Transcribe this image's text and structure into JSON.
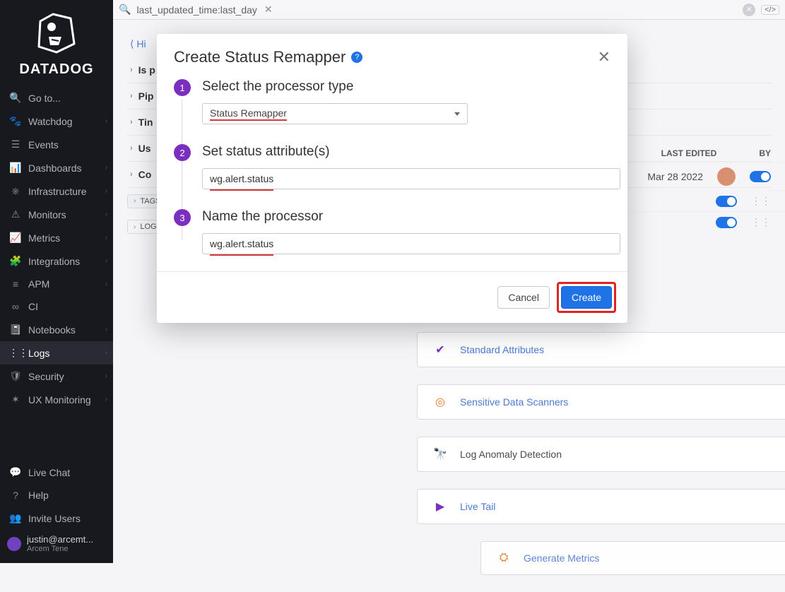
{
  "brand": "DATADOG",
  "sidebar": {
    "goto": "Go to...",
    "items": [
      {
        "label": "Watchdog"
      },
      {
        "label": "Events"
      },
      {
        "label": "Dashboards"
      },
      {
        "label": "Infrastructure"
      },
      {
        "label": "Monitors"
      },
      {
        "label": "Metrics"
      },
      {
        "label": "Integrations"
      },
      {
        "label": "APM"
      },
      {
        "label": "CI"
      },
      {
        "label": "Notebooks"
      },
      {
        "label": "Logs"
      },
      {
        "label": "Security"
      },
      {
        "label": "UX Monitoring"
      }
    ],
    "bottom": [
      {
        "label": "Live Chat"
      },
      {
        "label": "Help"
      },
      {
        "label": "Invite Users"
      }
    ],
    "user": {
      "email": "justin@arcemt...",
      "org": "Arcem Tene"
    }
  },
  "topbar": {
    "filter": "last_updated_time:last_day"
  },
  "accordion": {
    "back": "Hi",
    "rows": [
      "Is p",
      "Pip",
      "Tin",
      "Us",
      "Co"
    ],
    "tags": "TAGS",
    "logs": "LOGS"
  },
  "table": {
    "col1": "LAST EDITED",
    "col2": "BY",
    "date": "Mar 28 2022"
  },
  "cards": {
    "std": "Standard Attributes",
    "sds": "Sensitive Data Scanners",
    "lad": "Log Anomaly Detection",
    "lt": "Live Tail",
    "gm": "Generate Metrics"
  },
  "modal": {
    "title": "Create Status Remapper",
    "step1_title": "Select the processor type",
    "step1_value": "Status Remapper",
    "step2_title": "Set status attribute(s)",
    "step2_value": "wg.alert.status",
    "step3_title": "Name the processor",
    "step3_value": "wg.alert.status",
    "cancel": "Cancel",
    "create": "Create"
  }
}
